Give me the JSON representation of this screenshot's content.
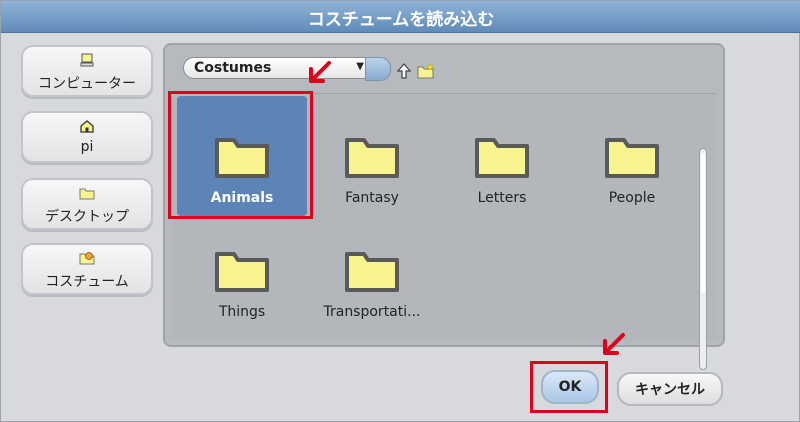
{
  "window": {
    "title": "コスチュームを読み込む"
  },
  "sidebar": {
    "items": [
      {
        "label": "コンピューター",
        "icon": "computer-icon"
      },
      {
        "label": "pi",
        "icon": "home-icon"
      },
      {
        "label": "デスクトップ",
        "icon": "folder-icon"
      },
      {
        "label": "コスチューム",
        "icon": "costume-icon"
      }
    ]
  },
  "path_selector": {
    "value": "Costumes"
  },
  "toolbar": {
    "up_icon": "up-arrow-icon",
    "new_folder_icon": "new-folder-icon"
  },
  "folders": [
    {
      "name": "Animals",
      "selected": true
    },
    {
      "name": "Fantasy",
      "selected": false
    },
    {
      "name": "Letters",
      "selected": false
    },
    {
      "name": "People",
      "selected": false
    },
    {
      "name": "Things",
      "selected": false
    },
    {
      "name": "Transportati...",
      "selected": false
    }
  ],
  "buttons": {
    "ok": "OK",
    "cancel": "キャンセル"
  },
  "colors": {
    "accent_selection": "#5d84b6",
    "folder_fill": "#f7f48e",
    "highlight_red": "#e0001b"
  }
}
